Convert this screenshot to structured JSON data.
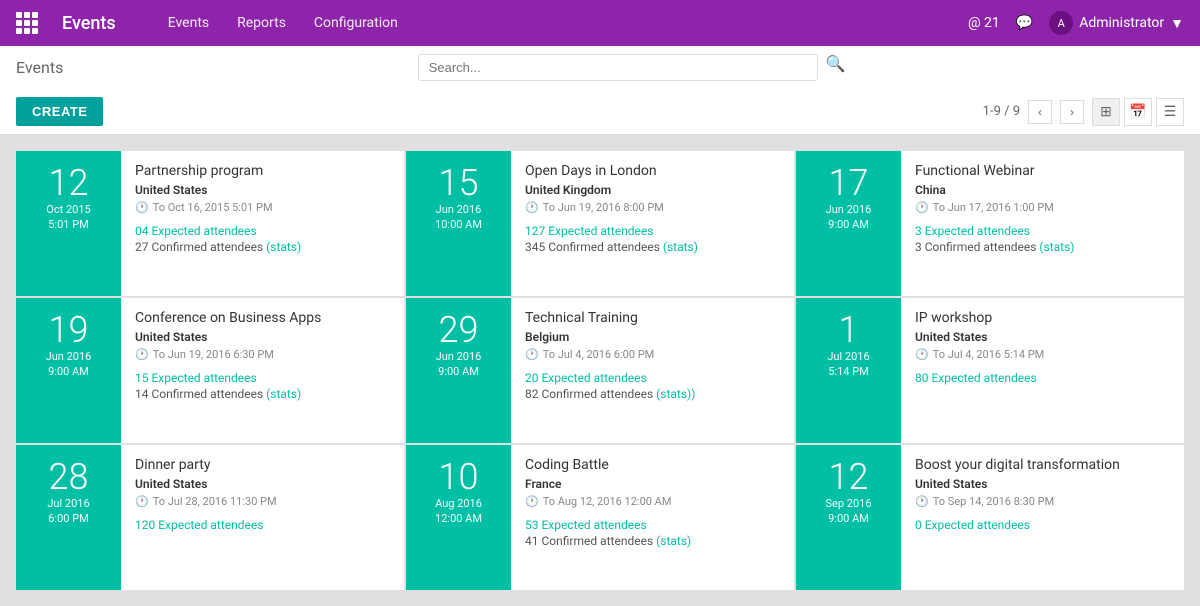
{
  "app": {
    "name": "Events",
    "nav": [
      "Events",
      "Reports",
      "Configuration"
    ],
    "topbar_right": {
      "notifications": "@ 21",
      "admin_label": "Administrator"
    }
  },
  "subheader": {
    "title": "Events",
    "search_placeholder": "Search...",
    "create_label": "CREATE",
    "pagination": "1-9 / 9"
  },
  "events": [
    {
      "day": "12",
      "month_year": "Oct 2015",
      "time": "5:01 PM",
      "name": "Partnership program",
      "country": "United States",
      "to": "To Oct 16, 2015 5:01 PM",
      "expected": "04",
      "expected_label": "Expected attendees",
      "confirmed": "27",
      "confirmed_label": "Confirmed attendees",
      "has_stats": true
    },
    {
      "day": "15",
      "month_year": "Jun 2016",
      "time": "10:00 AM",
      "name": "Open Days in London",
      "country": "United Kingdom",
      "to": "To Jun 19, 2016 8:00 PM",
      "expected": "127",
      "expected_label": "Expected attendees",
      "confirmed": "345",
      "confirmed_label": "Confirmed attendees",
      "has_stats": true
    },
    {
      "day": "17",
      "month_year": "Jun 2016",
      "time": "9:00 AM",
      "name": "Functional Webinar",
      "country": "China",
      "to": "To Jun 17, 2016 1:00 PM",
      "expected": "3",
      "expected_label": "Expected attendees",
      "confirmed": "3",
      "confirmed_label": "Confirmed attendees",
      "has_stats": true
    },
    {
      "day": "19",
      "month_year": "Jun 2016",
      "time": "9:00 AM",
      "name": "Conference on Business Apps",
      "country": "United States",
      "to": "To Jun 19, 2016 6:30 PM",
      "expected": "15",
      "expected_label": "Expected attendees",
      "confirmed": "14",
      "confirmed_label": "Confirmed attendees",
      "has_stats": true
    },
    {
      "day": "29",
      "month_year": "Jun 2016",
      "time": "9:00 AM",
      "name": "Technical Training",
      "country": "Belgium",
      "to": "To Jul 4, 2016 6:00 PM",
      "expected": "20",
      "expected_label": "Expected attendees",
      "confirmed": "82",
      "confirmed_label": "Confirmed attendees",
      "has_stats": true,
      "stats_suffix": ")"
    },
    {
      "day": "1",
      "month_year": "Jul 2016",
      "time": "5:14 PM",
      "name": "IP workshop",
      "country": "United States",
      "to": "To Jul 4, 2016 5:14 PM",
      "expected": "80",
      "expected_label": "Expected attendees",
      "confirmed": null,
      "has_stats": false
    },
    {
      "day": "28",
      "month_year": "Jul 2016",
      "time": "6:00 PM",
      "name": "Dinner party",
      "country": "United States",
      "to": "To Jul 28, 2016 11:30 PM",
      "expected": "120",
      "expected_label": "Expected attendees",
      "confirmed": null,
      "has_stats": false
    },
    {
      "day": "10",
      "month_year": "Aug 2016",
      "time": "12:00 AM",
      "name": "Coding Battle",
      "country": "France",
      "to": "To Aug 12, 2016 12:00 AM",
      "expected": "53",
      "expected_label": "Expected attendees",
      "confirmed": "41",
      "confirmed_label": "Confirmed attendees",
      "has_stats": true
    },
    {
      "day": "12",
      "month_year": "Sep 2016",
      "time": "9:00 AM",
      "name": "Boost your digital transformation",
      "country": "United States",
      "to": "To Sep 14, 2016 8:30 PM",
      "expected": "0",
      "expected_label": "Expected attendees",
      "confirmed": null,
      "has_stats": false
    }
  ]
}
